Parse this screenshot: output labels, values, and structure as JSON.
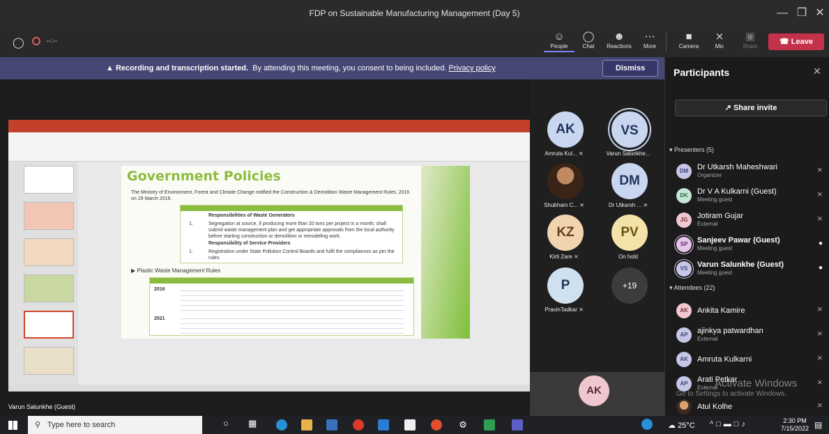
{
  "window": {
    "title": "FDP on Sustainable Manufacturing Management (Day 5)",
    "timer": "--:--"
  },
  "toolbar": {
    "people": "People",
    "chat": "Chat",
    "reactions": "Reactions",
    "more": "More",
    "camera": "Camera",
    "mic": "Mic",
    "share": "Share",
    "leave": "Leave"
  },
  "banner": {
    "bold": "Recording and transcription started.",
    "text": "By attending this meeting, you consent to being included.",
    "link": "Privacy policy",
    "dismiss": "Dismiss"
  },
  "slide": {
    "title": "Government Policies",
    "intro": "The Ministry of Environment, Forest and Climate Change notified the Construction & Demolition Waste Management Rules, 2016 on 29 March 2016.",
    "r1_head": "Responsibilities of Waste Generators",
    "r1_num": "1.",
    "r1_text": "Segregation at source, if producing more than 20 tons per project in a month; shall submit waste management plan and get appropriate approvals from the local authority before starting construction or demolition or remodeling work.",
    "r2_head": "Responsibility of Service Providers",
    "r2_num": "1.",
    "r2_text": "Registration under State Pollution Control Boards and fulfil the compliances as per the rules.",
    "plastic": "Plastic Waste Management Rules",
    "year1": "2016",
    "year2": "2021"
  },
  "presenter_label": "Varun Salunkhe (Guest)",
  "gallery": [
    {
      "initials": "AK",
      "name": "Amruta Kul...",
      "color": "#c9d6f0"
    },
    {
      "initials": "VS",
      "name": "Varun Salunkhe...",
      "color": "#c9d6f0"
    },
    {
      "initials": "",
      "name": "Shubham C...",
      "color": "#7a4a2a"
    },
    {
      "initials": "DM",
      "name": "Dr Utkarsh ...",
      "color": "#c9d6f0"
    },
    {
      "initials": "KZ",
      "name": "Kirti Zare",
      "color": "#f2d3b0"
    },
    {
      "initials": "PV",
      "name": "On hold",
      "color": "#f3e3a8"
    },
    {
      "initials": "P",
      "name": "PravinTadkar",
      "color": "#cfe0ef"
    },
    {
      "initials": "+19",
      "name": "",
      "color": "#3c3c3c"
    }
  ],
  "self_view": {
    "initials": "AK"
  },
  "panel": {
    "title": "Participants",
    "share_invite": "Share invite",
    "presenters_label": "Presenters (5)",
    "attendees_label": "Attendees (22)",
    "presenters": [
      {
        "initials": "DM",
        "name": "Dr Utkarsh Maheshwari",
        "role": "Organizer"
      },
      {
        "initials": "DK",
        "name": "Dr V A Kulkarni (Guest)",
        "role": "Meeting guest"
      },
      {
        "initials": "JG",
        "name": "Jotiram Gujar",
        "role": "External"
      },
      {
        "initials": "SP",
        "name": "Sanjeev Pawar (Guest)",
        "role": "Meeting guest"
      },
      {
        "initials": "VS",
        "name": "Varun Salunkhe (Guest)",
        "role": "Meeting guest"
      }
    ],
    "attendees": [
      {
        "initials": "AK",
        "name": "Ankita Kamire",
        "role": ""
      },
      {
        "initials": "AP",
        "name": "ajinkya patwardhan",
        "role": "External"
      },
      {
        "initials": "AK",
        "name": "Amruta Kulkarni",
        "role": ""
      },
      {
        "initials": "AP",
        "name": "Arati Petkar",
        "role": "External"
      },
      {
        "initials": "",
        "name": "Atul Kolhe",
        "role": ""
      }
    ],
    "watermark1": "Activate Windows",
    "watermark2": "Go to Settings to activate Windows."
  },
  "taskbar": {
    "search": "Type here to search",
    "temp": "25°C",
    "time": "2:30 PM",
    "date": "7/15/2022"
  }
}
